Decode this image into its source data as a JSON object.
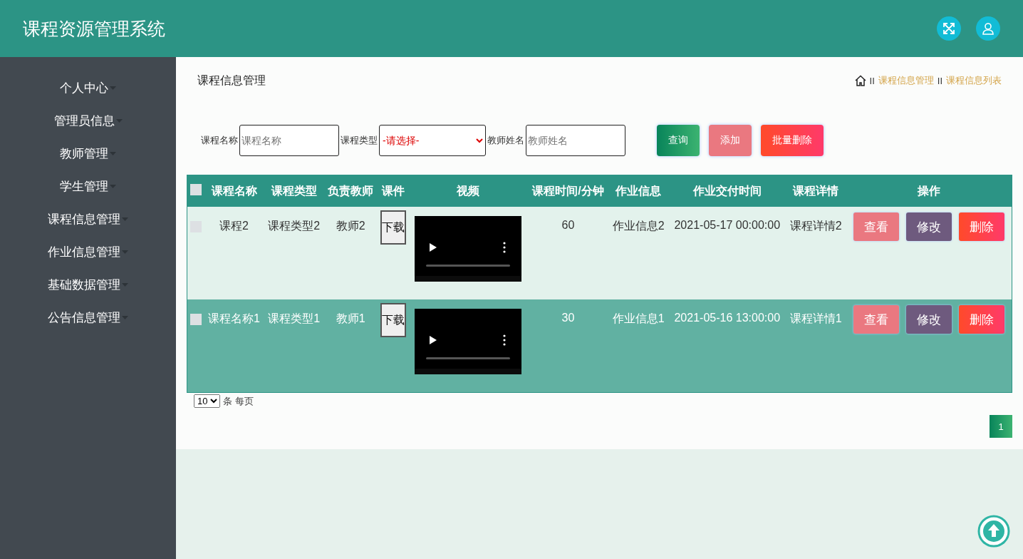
{
  "header": {
    "title": "课程资源管理系统"
  },
  "sidebar": {
    "items": [
      {
        "label": "个人中心"
      },
      {
        "label": "管理员信息"
      },
      {
        "label": "教师管理"
      },
      {
        "label": "学生管理"
      },
      {
        "label": "课程信息管理"
      },
      {
        "label": "作业信息管理"
      },
      {
        "label": "基础数据管理"
      },
      {
        "label": "公告信息管理"
      }
    ]
  },
  "page_title": "课程信息管理",
  "breadcrumb": [
    {
      "separator": "II",
      "label": "课程信息管理"
    },
    {
      "separator": "II",
      "label": "课程信息列表"
    }
  ],
  "search": {
    "fields": [
      {
        "kind": "text",
        "label": "课程名称",
        "placeholder": "课程名称"
      },
      {
        "kind": "select",
        "label": "课程类型",
        "value": "-请选择-"
      },
      {
        "kind": "text",
        "label": "教师姓名",
        "placeholder": "教师姓名"
      }
    ],
    "buttons": [
      {
        "kind": "query",
        "label": "查询"
      },
      {
        "kind": "add",
        "label": "添加"
      },
      {
        "kind": "batch-delete",
        "label": "批量删除"
      }
    ]
  },
  "table": {
    "select_all_checked": false,
    "columns": [
      "课程名称",
      "课程类型",
      "负责教师",
      "课件",
      "视频",
      "课程时间/分钟",
      "作业信息",
      "作业交付时间",
      "课程详情",
      "操作"
    ],
    "rows": [
      {
        "checked": false,
        "highlighted": false,
        "cells": [
          "课程2",
          "课程类型2",
          "教师2"
        ],
        "download": "下载",
        "duration": "60",
        "homework": "作业信息2",
        "due": "2021-05-17 00:00:00",
        "detail": "课程详情2",
        "actions": [
          {
            "kind": "view",
            "label": "查看"
          },
          {
            "kind": "edit",
            "label": "修改"
          },
          {
            "kind": "delete",
            "label": "删除"
          }
        ]
      },
      {
        "checked": false,
        "highlighted": true,
        "cells": [
          "课程名称1",
          "课程类型1",
          "教师1"
        ],
        "download": "下载",
        "duration": "30",
        "homework": "作业信息1",
        "due": "2021-05-16 13:00:00",
        "detail": "课程详情1",
        "actions": [
          {
            "kind": "view",
            "label": "查看"
          },
          {
            "kind": "edit",
            "label": "修改"
          },
          {
            "kind": "delete",
            "label": "删除"
          }
        ]
      }
    ]
  },
  "pagination": {
    "page_size": "10",
    "page_size_label": "条 每页",
    "pages": [
      {
        "label": "1",
        "selected": true
      }
    ]
  }
}
